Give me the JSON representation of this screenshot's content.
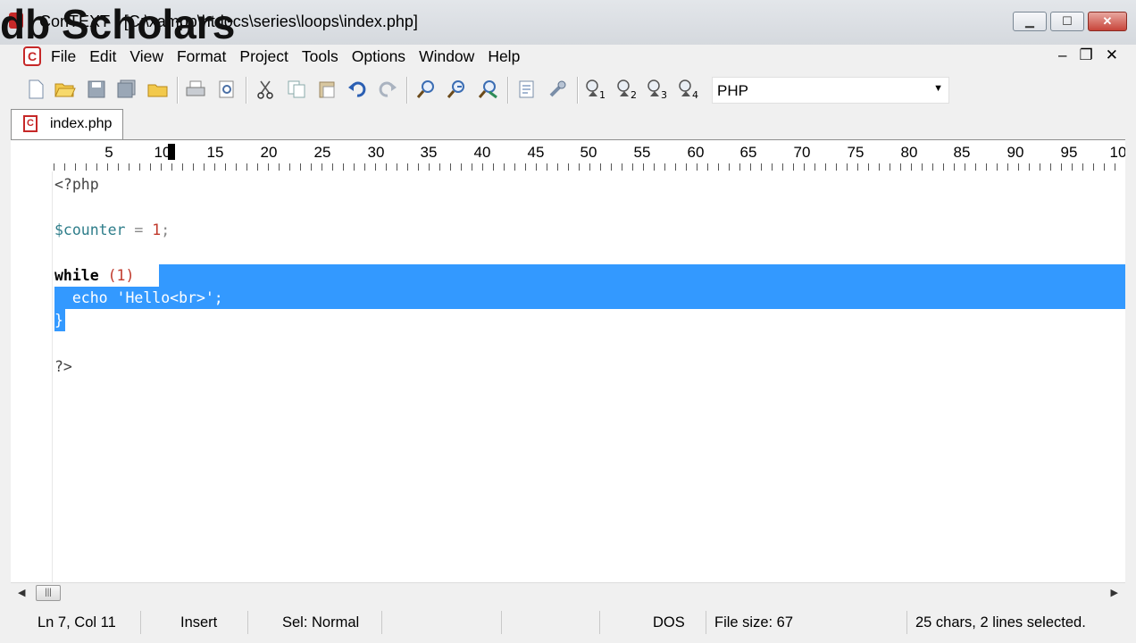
{
  "window": {
    "title": "ConTEXT - [C:\\xampp\\htdocs\\series\\loops\\index.php]",
    "watermark": "db Scholars",
    "controls": [
      "minimize",
      "maximize",
      "close"
    ]
  },
  "menu": {
    "items": [
      "File",
      "Edit",
      "View",
      "Format",
      "Project",
      "Tools",
      "Options",
      "Window",
      "Help"
    ],
    "mdi_controls": [
      "–",
      "❐",
      "✕"
    ]
  },
  "toolbar": {
    "icons": [
      "new-file-icon",
      "open-folder-icon",
      "save-icon",
      "save-all-icon",
      "project-folder-icon",
      "print-icon",
      "print-preview-icon",
      "cut-icon",
      "copy-icon",
      "paste-icon",
      "undo-icon",
      "redo-icon",
      "find-icon",
      "find-next-icon",
      "replace-icon",
      "file-info-icon",
      "tools-icon",
      "user-command-1-icon",
      "user-command-2-icon",
      "user-command-3-icon",
      "user-command-4-icon"
    ],
    "user_command_subscripts": [
      "1",
      "2",
      "3",
      "4"
    ],
    "language": "PHP"
  },
  "tabs": [
    {
      "label": "index.php",
      "active": true
    }
  ],
  "ruler": {
    "numbers": [
      "5",
      "10",
      "15",
      "20",
      "25",
      "30",
      "35",
      "40",
      "45",
      "50",
      "55",
      "60",
      "65",
      "70",
      "75",
      "80",
      "85",
      "90",
      "95",
      "10"
    ]
  },
  "editor": {
    "lines": [
      {
        "text": "<?php"
      },
      {
        "text": ""
      },
      {
        "var": "$counter",
        "op": " = ",
        "num": "1",
        "end": ";"
      },
      {
        "text": ""
      },
      {
        "kw": "while",
        "sp": " ",
        "paren": "(1)",
        "brace": " {"
      },
      {
        "text": "  echo 'Hello<br>';"
      },
      {
        "text": "}"
      },
      {
        "text": ""
      },
      {
        "text": "?>"
      }
    ]
  },
  "statusbar": {
    "position": "Ln 7, Col 11",
    "mode": "Insert",
    "selection_mode": "Sel: Normal",
    "line_ending": "DOS",
    "file_size": "File size: 67",
    "selection_info": "25 chars, 2 lines selected."
  }
}
